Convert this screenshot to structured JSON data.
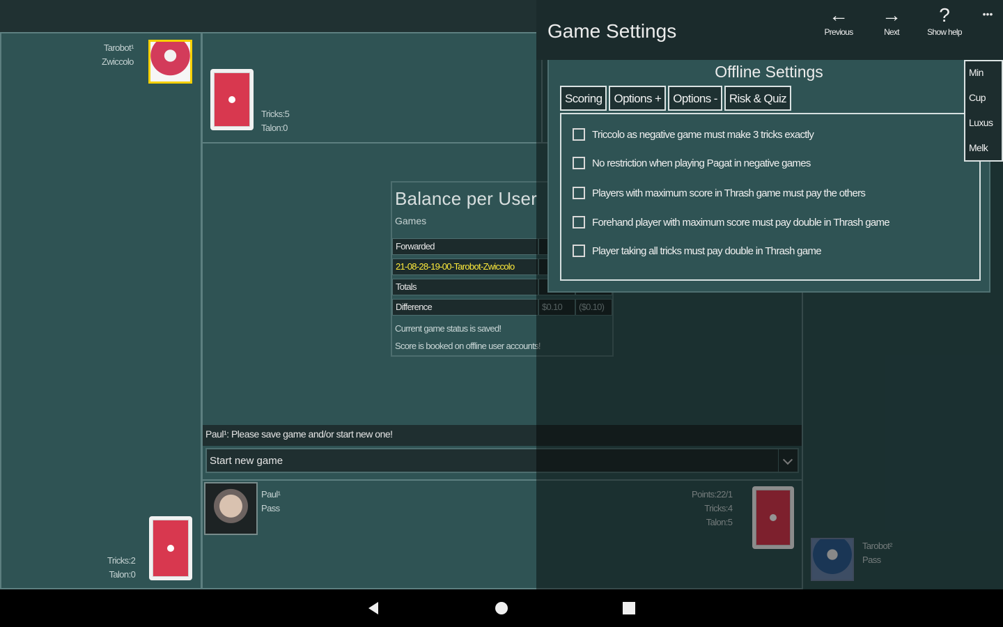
{
  "left_player": {
    "name_line1": "Tarobot¹",
    "name_line2": "Zwiccolo",
    "tricks": "Tricks:2",
    "talon": "Talon:0"
  },
  "top_player": {
    "tricks": "Tricks:5",
    "talon": "Talon:0"
  },
  "balance": {
    "title": "Balance per User",
    "subtitle": "Games",
    "rows": [
      {
        "label": "Forwarded",
        "values": [
          "",
          ""
        ]
      },
      {
        "label": "21-08-28-19-00-Tarobot-Zwiccolo",
        "values": [
          "",
          ""
        ]
      },
      {
        "label": "Totals",
        "values": [
          "",
          ""
        ]
      },
      {
        "label": "Difference",
        "values": [
          "$0.10",
          "($0.10)"
        ]
      }
    ],
    "status1": "Current game status is saved!",
    "status2": "Score is booked on offline user accounts!"
  },
  "message_bar": "Paul¹: Please save game and/or start new one!",
  "select_value": "Start new game",
  "bottom_player": {
    "name": "Paul¹",
    "status": "Pass",
    "points": "Points:22/1",
    "tricks": "Tricks:4",
    "talon": "Talon:5"
  },
  "right_player": {
    "name": "Tarobot²",
    "status": "Pass"
  },
  "settings": {
    "title": "Game Settings",
    "toolbar": [
      {
        "glyph": "←",
        "label": "Previous"
      },
      {
        "glyph": "→",
        "label": "Next"
      },
      {
        "glyph": "?",
        "label": "Show help"
      }
    ],
    "more": "•••",
    "panel_title": "Offline Settings",
    "tabs": [
      "Scoring",
      "Options +",
      "Options -",
      "Risk & Quiz"
    ],
    "options": [
      "Triccolo as negative game must make 3 tricks exactly",
      "No restriction when playing Pagat in negative games",
      "Players with maximum score in Thrash game must pay the others",
      "Forehand player with maximum score must pay double in Thrash game",
      "Player taking all tricks must pay double in Thrash game"
    ],
    "side_menu": [
      "Min",
      "Cup",
      "Luxus",
      "Melk"
    ]
  }
}
